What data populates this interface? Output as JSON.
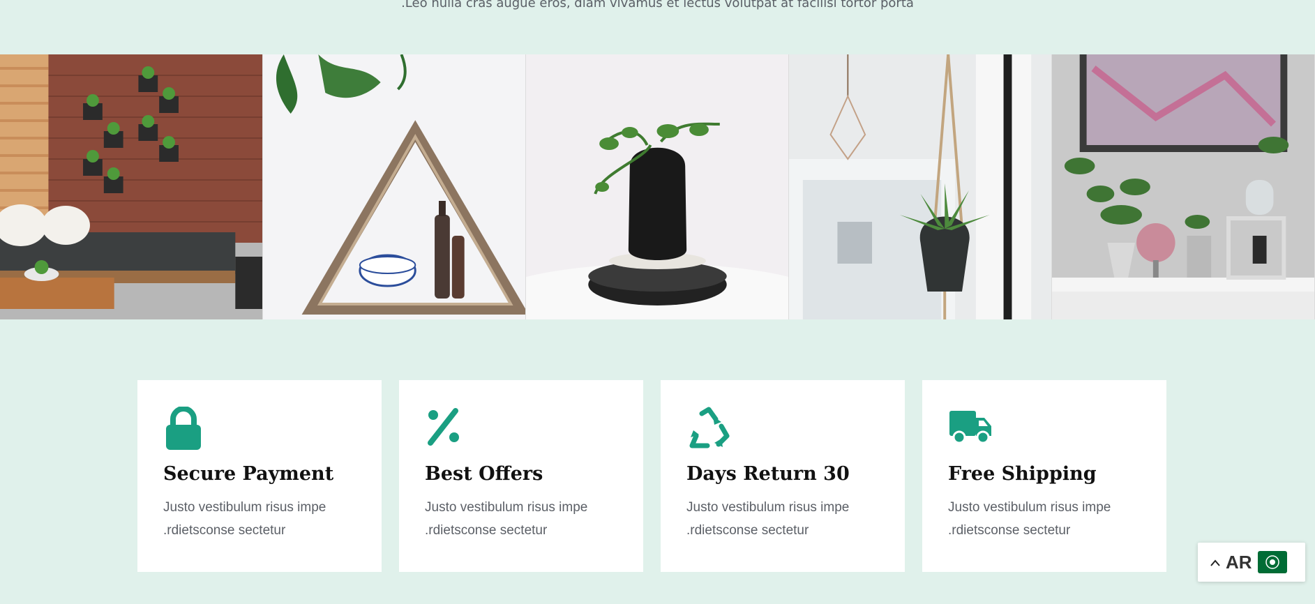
{
  "intro_text": ".Leo nulla cras augue eros, diam vivamus et lectus volutpat at facilisi tortor porta",
  "gallery": [
    {
      "name": "outdoor-lounge-photo"
    },
    {
      "name": "triangle-shelf-photo"
    },
    {
      "name": "black-vase-photo"
    },
    {
      "name": "hanging-plant-photo"
    },
    {
      "name": "shelf-plants-photo"
    }
  ],
  "features": [
    {
      "icon": "lock-icon",
      "title": "Secure Payment",
      "text": "Justo vestibulum risus impe .rdietsconse sectetur"
    },
    {
      "icon": "percent-icon",
      "title": "Best Offers",
      "text": "Justo vestibulum risus impe .rdietsconse sectetur"
    },
    {
      "icon": "recycle-icon",
      "title": "Days Return 30",
      "text": "Justo vestibulum risus impe .rdietsconse sectetur"
    },
    {
      "icon": "truck-icon",
      "title": "Free Shipping",
      "text": "Justo vestibulum risus impe .rdietsconse sectetur"
    }
  ],
  "language_switcher": {
    "caret": "^",
    "code": "AR",
    "flag": "saudi-flag-icon"
  },
  "colors": {
    "accent": "#1a9f82",
    "background": "#e0f1eb",
    "flag_green": "#006c35"
  }
}
